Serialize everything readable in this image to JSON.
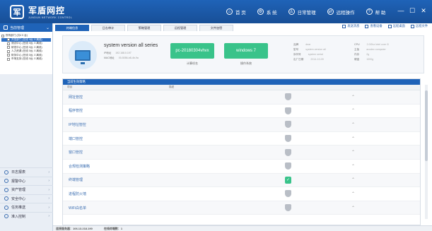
{
  "app": {
    "title": "军盾网控",
    "subtitle": "JUNDUN NETWORK CONTROL",
    "logo_mark": "军"
  },
  "topnav": [
    {
      "icon": "home-icon",
      "glyph": "⌂",
      "label": "首 页"
    },
    {
      "icon": "system-icon",
      "glyph": "⚙",
      "label": "系 统"
    },
    {
      "icon": "user-icon",
      "glyph": "♙",
      "label": "日常管理"
    },
    {
      "icon": "remote-icon",
      "glyph": "⇄",
      "label": "远程操作"
    },
    {
      "icon": "help-icon",
      "glyph": "?",
      "label": "帮 助"
    }
  ],
  "window_controls": [
    "—",
    "☐",
    "✕"
  ],
  "sidebar": {
    "header": "当前管理",
    "tree": [
      {
        "label": "所有部门 (共4 0 台)",
        "level": 0,
        "selected": false
      },
      {
        "label": "开发部门 (在线 4台, 0 离线)",
        "level": 1,
        "selected": true
      },
      {
        "label": "测试中心 (在线 0台, 0 离线)",
        "level": 1,
        "selected": false
      },
      {
        "label": "研发中心 (在线 0台, 0 离线)",
        "level": 1,
        "selected": false
      },
      {
        "label": "人力资源 (在线 0台, 0 离线)",
        "level": 1,
        "selected": false
      },
      {
        "label": "财务中心 (在线 0台, 0 离线)",
        "level": 1,
        "selected": false
      },
      {
        "label": "市场支持 (在线 0台, 0 离线)",
        "level": 1,
        "selected": false
      }
    ],
    "menu": [
      {
        "icon": "log-icon",
        "label": "日志报表"
      },
      {
        "icon": "alarm-icon",
        "label": "报警中心"
      },
      {
        "icon": "asset-icon",
        "label": "资产管理"
      },
      {
        "icon": "security-icon",
        "label": "安全中心"
      },
      {
        "icon": "task-icon",
        "label": "任务推送"
      },
      {
        "icon": "access-icon",
        "label": "准入控制"
      }
    ]
  },
  "tabs": [
    "终端信息",
    "日志审计",
    "策略管理",
    "远程管理",
    "文件加密"
  ],
  "toolbar": [
    {
      "icon": "message-icon",
      "label": "发送消息"
    },
    {
      "icon": "scan-icon",
      "label": "查看设备"
    },
    {
      "icon": "remote-desktop-icon",
      "label": "远程桌面"
    },
    {
      "icon": "file-icon",
      "label": "远程文件"
    }
  ],
  "device": {
    "name": "system version all series",
    "ip_label": "IP地址",
    "ip_value": "192.168.0.197",
    "mac_label": "MAC地址",
    "mac_value": "00-5056-b8-4b-9a",
    "computer_name": "pc-20180304vhvx",
    "computer_name_label": "计算机名",
    "os": "windows 7",
    "os_label": "操作系统",
    "info_left": [
      {
        "k": "品牌",
        "v": "dear"
      },
      {
        "k": "型号",
        "v": "system version all"
      },
      {
        "k": "序列号",
        "v": "system serial"
      },
      {
        "k": "出厂日期",
        "v": "2014-10-09"
      }
    ],
    "info_right": [
      {
        "k": "CPU",
        "v": "2.0Ghz Intel core i3"
      },
      {
        "k": "主板",
        "v": "acodec computer"
      },
      {
        "k": "内存",
        "v": "2g"
      },
      {
        "k": "硬盘",
        "v": "1000g"
      }
    ]
  },
  "policy": {
    "title": "当前生效策略",
    "col_item": "项目",
    "col_desc": "描述",
    "rows": [
      {
        "name": "网址管控",
        "enabled": false
      },
      {
        "name": "程序管控",
        "enabled": false
      },
      {
        "name": "IP地址管控",
        "enabled": false
      },
      {
        "name": "端口管控",
        "enabled": false
      },
      {
        "name": "窗口管控",
        "enabled": false
      },
      {
        "name": "合规检测策略",
        "enabled": false
      },
      {
        "name": "终端管理",
        "enabled": true
      },
      {
        "name": "进程防火墙",
        "enabled": false
      },
      {
        "name": "WiFi白名单",
        "enabled": false
      }
    ]
  },
  "status": {
    "server_label": "连接服务器：",
    "server_value": "106.13.218.190",
    "online_label": "在线终端数：",
    "online_value": "1"
  }
}
